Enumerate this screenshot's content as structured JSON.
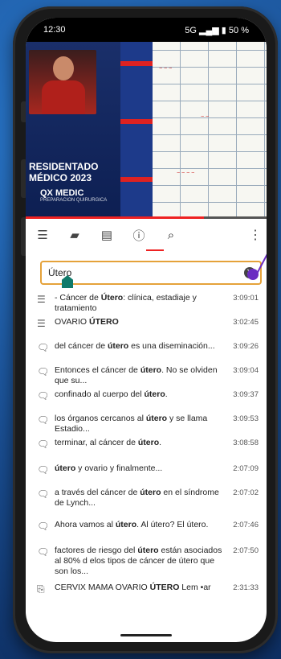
{
  "status": {
    "time": "12:30",
    "battery": "50 %",
    "network": "5G"
  },
  "video": {
    "title_line1": "RESIDENTADO",
    "title_line2": "MÉDICO 2023",
    "logo": "QX MEDIC",
    "logo_tagline": "PREPARACIÓN QUIRÚRGICA",
    "progress_fraction": 0.74
  },
  "toolbar": {
    "tabs": [
      "chapters",
      "chat",
      "transcript",
      "info",
      "search"
    ],
    "active_tab": "search"
  },
  "search": {
    "value": "Útero",
    "placeholder": ""
  },
  "results": [
    {
      "icon": "chapter",
      "pre": "- Cáncer de ",
      "hit": "Útero",
      "post": ": clínica, estadiaje y tratamiento",
      "time": "3:09:01"
    },
    {
      "icon": "chapter",
      "pre": "OVARIO ",
      "hit": "ÚTERO",
      "post": "",
      "time": "3:02:45"
    },
    {
      "icon": "speech",
      "pre": "del cáncer de ",
      "hit": "útero",
      "post": " es una diseminación...",
      "time": "3:09:26"
    },
    {
      "icon": "speech",
      "pre": "Entonces el cáncer de ",
      "hit": "útero",
      "post": ". No se olviden que su...",
      "time": "3:09:04"
    },
    {
      "icon": "speech",
      "pre": "confinado al cuerpo del ",
      "hit": "útero",
      "post": ".",
      "time": "3:09:37"
    },
    {
      "icon": "speech",
      "pre": "los órganos cercanos al ",
      "hit": "útero",
      "post": " y se llama Estadio...",
      "time": "3:09:53"
    },
    {
      "icon": "speech",
      "pre": "terminar, al cáncer de ",
      "hit": "útero",
      "post": ".",
      "time": "3:08:58"
    },
    {
      "icon": "speech",
      "pre": "",
      "hit": "útero",
      "post": " y ovario y finalmente...",
      "time": "2:07:09"
    },
    {
      "icon": "speech",
      "pre": "a través del cáncer de ",
      "hit": "útero",
      "post": " en el síndrome de Lynch...",
      "time": "2:07:02"
    },
    {
      "icon": "speech",
      "pre": "Ahora vamos al ",
      "hit": "útero",
      "post": ". Al útero? El útero.",
      "time": "2:07:46"
    },
    {
      "icon": "speech",
      "pre": "factores de riesgo del ",
      "hit": "útero",
      "post": " están asociados al 80% d elos tipos de cáncer de útero que son los...",
      "time": "2:07:50"
    },
    {
      "icon": "caption",
      "pre": "CERVIX MAMA OVARIO ",
      "hit": "ÚTERO",
      "post": " Lem •ar",
      "time": "2:31:33"
    }
  ]
}
